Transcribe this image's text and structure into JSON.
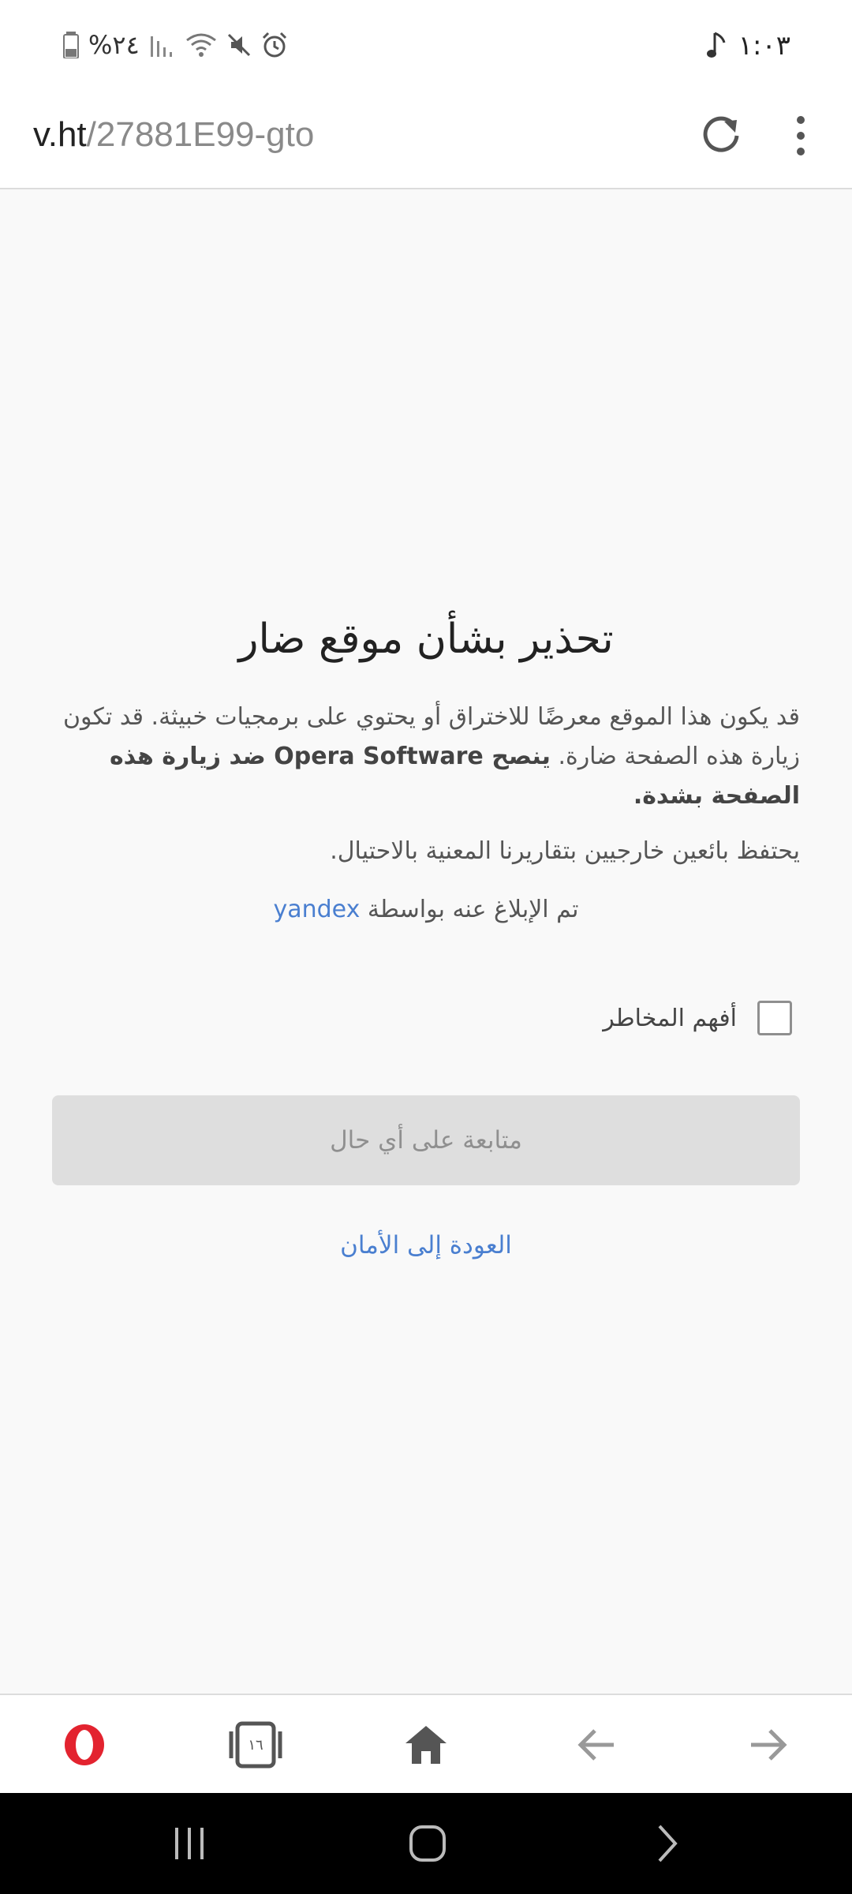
{
  "status_bar": {
    "time": "١:٠٣",
    "battery": "%٢٤",
    "icons": [
      "music-note-icon",
      "battery-icon",
      "signal-icon",
      "wifi-icon",
      "mute-icon",
      "alarm-icon"
    ]
  },
  "address_bar": {
    "url_host": "v.ht",
    "url_path": "/27881E99-gto"
  },
  "warning": {
    "title": "تحذير بشأن موقع ضار",
    "body_part1": "قد يكون هذا الموقع معرضًا للاختراق أو يحتوي على برمجيات خبيثة. قد تكون زيارة هذه الصفحة ضارة. ",
    "body_bold": "ينصح Opera Software ضد زيارة هذه الصفحة بشدة.",
    "body2": "يحتفظ بائعين خارجيين بتقاريرنا المعنية بالاحتيال.",
    "reported_prefix": "تم الإبلاغ عنه بواسطة",
    "reported_by": "yandex",
    "checkbox_label": "أفهم المخاطر",
    "continue_label": "متابعة على أي حال",
    "back_label": "العودة إلى الأمان"
  },
  "toolbar": {
    "tabs_count": "١٦"
  },
  "colors": {
    "link": "#4a7fd0",
    "opera_red": "#e3232f",
    "disabled_button": "#dedede"
  }
}
